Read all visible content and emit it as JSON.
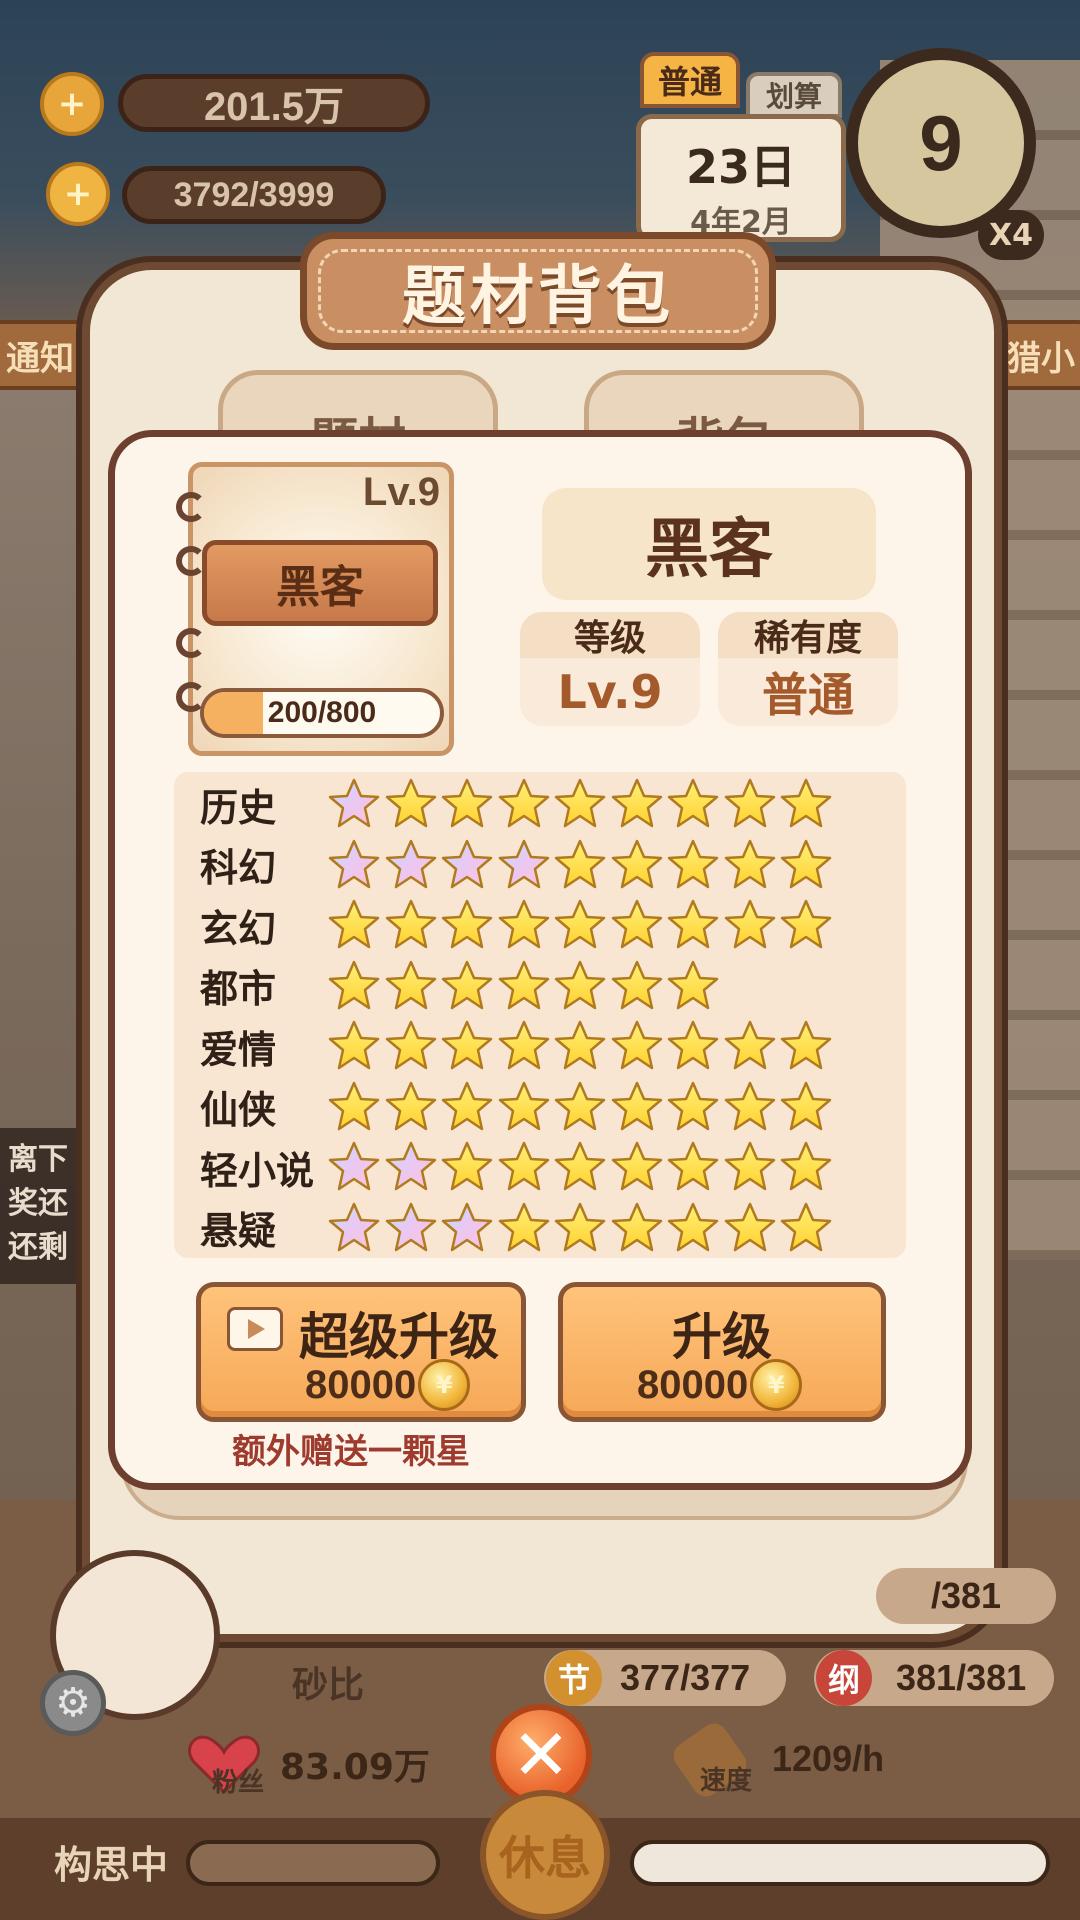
{
  "hud": {
    "coins": "201.5万",
    "energy": "3792/3999",
    "mode_tab": "普通",
    "mode_tab2": "划算",
    "day": "23日",
    "date": "4年2月",
    "clock_value": "9",
    "speed_multiplier": "X4",
    "left_tab": "通知",
    "right_tab": "猎小",
    "offline_text": [
      "离下",
      "奖还",
      "还剩"
    ],
    "player_name": "砂比",
    "stat_partial": "/381",
    "stat_jie_badge": "节",
    "stat_jie": "377/377",
    "stat_gang_badge": "纲",
    "stat_gang": "381/381",
    "fans_label": "粉丝",
    "fans_value": "83.09万",
    "speed_label": "速度",
    "speed_value": "1209/h",
    "status_left": "构思中",
    "rest_button": "休息"
  },
  "modal": {
    "title": "题材背包",
    "tabs": [
      "题材",
      "背包"
    ],
    "book": {
      "level": "Lv.9",
      "label": "黑客",
      "progress_text": "200/800",
      "progress_fraction": 0.25
    },
    "name": "黑客",
    "level_label": "等级",
    "level_value": "Lv.9",
    "rarity_label": "稀有度",
    "rarity_value": "普通",
    "genres": [
      {
        "name": "历史",
        "stars": [
          "rainbow",
          "gold",
          "gold",
          "gold",
          "gold",
          "gold",
          "gold",
          "gold",
          "gold"
        ]
      },
      {
        "name": "科幻",
        "stars": [
          "rainbow",
          "rainbow",
          "rainbow",
          "rainbow",
          "gold",
          "gold",
          "gold",
          "gold",
          "gold"
        ]
      },
      {
        "name": "玄幻",
        "stars": [
          "gold",
          "gold",
          "gold",
          "gold",
          "gold",
          "gold",
          "gold",
          "gold",
          "gold"
        ]
      },
      {
        "name": "都市",
        "stars": [
          "gold",
          "gold",
          "gold",
          "gold",
          "gold",
          "gold",
          "gold"
        ]
      },
      {
        "name": "爱情",
        "stars": [
          "gold",
          "gold",
          "gold",
          "gold",
          "gold",
          "gold",
          "gold",
          "gold",
          "gold"
        ]
      },
      {
        "name": "仙侠",
        "stars": [
          "gold",
          "gold",
          "gold",
          "gold",
          "gold",
          "gold",
          "gold",
          "gold",
          "gold"
        ]
      },
      {
        "name": "轻小说",
        "stars": [
          "rainbow",
          "rainbow",
          "gold",
          "gold",
          "gold",
          "gold",
          "gold",
          "gold",
          "gold"
        ]
      },
      {
        "name": "悬疑",
        "stars": [
          "rainbow",
          "rainbow",
          "rainbow",
          "gold",
          "gold",
          "gold",
          "gold",
          "gold",
          "gold"
        ]
      }
    ],
    "super_upgrade": {
      "label": "超级升级",
      "cost": "80000"
    },
    "upgrade": {
      "label": "升级",
      "cost": "80000"
    },
    "bonus_text": "额外赠送一颗星",
    "coin_glyph": "¥"
  },
  "colors": {
    "gold_star": "#ffd12e",
    "rainbow_star": "#e8c8f4",
    "accent": "#f6a858"
  }
}
